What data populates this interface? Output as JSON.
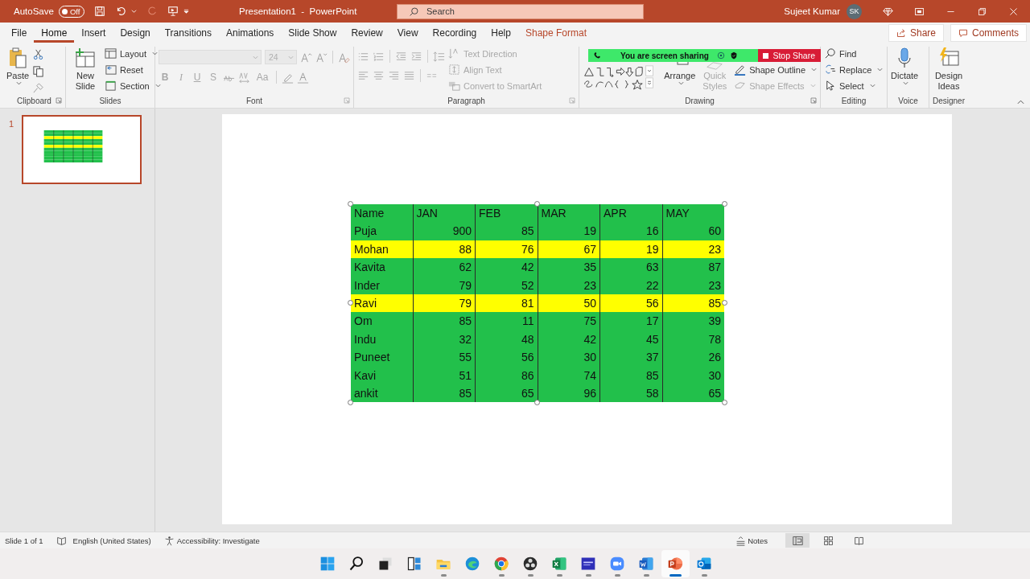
{
  "title_bar": {
    "autosave": "AutoSave",
    "autosave_toggle": {
      "label": "Off",
      "on": false
    },
    "title": "Presentation1  -  PowerPoint",
    "search": {
      "placeholder": "Search"
    },
    "user": "Sujeet Kumar",
    "avatar": "SK"
  },
  "tabs": [
    {
      "label": "File",
      "selected": false,
      "kind": "normal"
    },
    {
      "label": "Home",
      "selected": true,
      "kind": "normal"
    },
    {
      "label": "Insert",
      "selected": false,
      "kind": "normal"
    },
    {
      "label": "Design",
      "selected": false,
      "kind": "normal"
    },
    {
      "label": "Transitions",
      "selected": false,
      "kind": "normal"
    },
    {
      "label": "Animations",
      "selected": false,
      "kind": "normal"
    },
    {
      "label": "Slide Show",
      "selected": false,
      "kind": "normal"
    },
    {
      "label": "Review",
      "selected": false,
      "kind": "normal"
    },
    {
      "label": "View",
      "selected": false,
      "kind": "normal"
    },
    {
      "label": "Recording",
      "selected": false,
      "kind": "normal"
    },
    {
      "label": "Help",
      "selected": false,
      "kind": "normal"
    },
    {
      "label": "Shape Format",
      "selected": false,
      "kind": "contextual"
    }
  ],
  "share": "Share",
  "comments": "Comments",
  "screen_share": {
    "message": "You are screen sharing",
    "stop": "Stop Share"
  },
  "ribbon": {
    "clipboard": {
      "label": "Clipboard",
      "paste": "Paste"
    },
    "slides": {
      "label": "Slides",
      "new_slide": "New Slide",
      "layout": "Layout",
      "reset": "Reset",
      "section": "Section"
    },
    "font": {
      "label": "Font",
      "font_name": {
        "disabled": true
      },
      "font_size": {
        "value": "24",
        "disabled": true
      },
      "styles": [
        {
          "label": "B",
          "disabled": true
        },
        {
          "label": "I",
          "disabled": true
        },
        {
          "label": "U",
          "disabled": true
        },
        {
          "label": "S",
          "disabled": true
        }
      ],
      "change_case": {
        "label": "Aa",
        "disabled": true
      }
    },
    "paragraph": {
      "label": "Paragraph",
      "text_direction": {
        "label": "Text Direction",
        "disabled": true
      },
      "align_text": {
        "label": "Align Text",
        "disabled": true
      },
      "smartart": {
        "label": "Convert to SmartArt",
        "disabled": true
      }
    },
    "drawing": {
      "label": "Drawing",
      "arrange": {
        "label": "Arrange",
        "disabled": false
      },
      "quick_styles": {
        "label": "Quick Styles",
        "disabled": true
      },
      "shape_outline": {
        "label": "Shape Outline",
        "disabled": false
      },
      "shape_effects": {
        "label": "Shape Effects",
        "disabled": true
      }
    },
    "editing": {
      "label": "Editing",
      "find": "Find",
      "replace": "Replace",
      "select": "Select"
    },
    "voice": {
      "label": "Voice",
      "dictate": "Dictate"
    },
    "designer": {
      "label": "Designer",
      "design_ideas": "Design Ideas"
    }
  },
  "slides_pane": {
    "slides": [
      {
        "number": "1",
        "selected": true
      }
    ]
  },
  "table": {
    "columns": [
      "Name",
      "JAN",
      "FEB",
      "MAR",
      "APR",
      "MAY"
    ],
    "header_row": {
      "color": "#22c04b"
    },
    "rows": [
      {
        "name": "Puja",
        "values": [
          "900",
          "85",
          "19",
          "16",
          "60"
        ],
        "color": "#22c04b"
      },
      {
        "name": "Mohan",
        "values": [
          "88",
          "76",
          "67",
          "19",
          "23"
        ],
        "color": "#ffff00"
      },
      {
        "name": "Kavita",
        "values": [
          "62",
          "42",
          "35",
          "63",
          "87"
        ],
        "color": "#22c04b"
      },
      {
        "name": "Inder",
        "values": [
          "79",
          "52",
          "23",
          "22",
          "23"
        ],
        "color": "#22c04b"
      },
      {
        "name": "Ravi",
        "values": [
          "79",
          "81",
          "50",
          "56",
          "85"
        ],
        "color": "#ffff00"
      },
      {
        "name": "Om",
        "values": [
          "85",
          "11",
          "75",
          "17",
          "39"
        ],
        "color": "#22c04b"
      },
      {
        "name": "Indu",
        "values": [
          "32",
          "48",
          "42",
          "45",
          "78"
        ],
        "color": "#22c04b"
      },
      {
        "name": "Puneet",
        "values": [
          "55",
          "56",
          "30",
          "37",
          "26"
        ],
        "color": "#22c04b"
      },
      {
        "name": "Kavi",
        "values": [
          "51",
          "86",
          "74",
          "85",
          "30"
        ],
        "color": "#22c04b"
      },
      {
        "name": "ankit",
        "values": [
          "85",
          "65",
          "96",
          "58",
          "65"
        ],
        "color": "#22c04b"
      }
    ]
  },
  "status_bar": {
    "slide": "Slide 1 of 1",
    "language": "English (United States)",
    "accessibility": "Accessibility: Investigate",
    "notes": "Notes",
    "views": [
      {
        "selected": true
      },
      {
        "selected": false
      },
      {
        "selected": false
      }
    ]
  },
  "taskbar": {
    "apps": [
      {
        "running": true,
        "selected": false
      },
      {
        "running": false,
        "selected": false
      },
      {
        "running": true,
        "selected": false
      },
      {
        "running": true,
        "selected": false
      },
      {
        "running": true,
        "selected": false
      },
      {
        "running": true,
        "selected": false
      },
      {
        "running": true,
        "selected": false
      },
      {
        "running": true,
        "selected": false
      },
      {
        "running": true,
        "selected": true
      },
      {
        "running": true,
        "selected": false
      }
    ]
  }
}
